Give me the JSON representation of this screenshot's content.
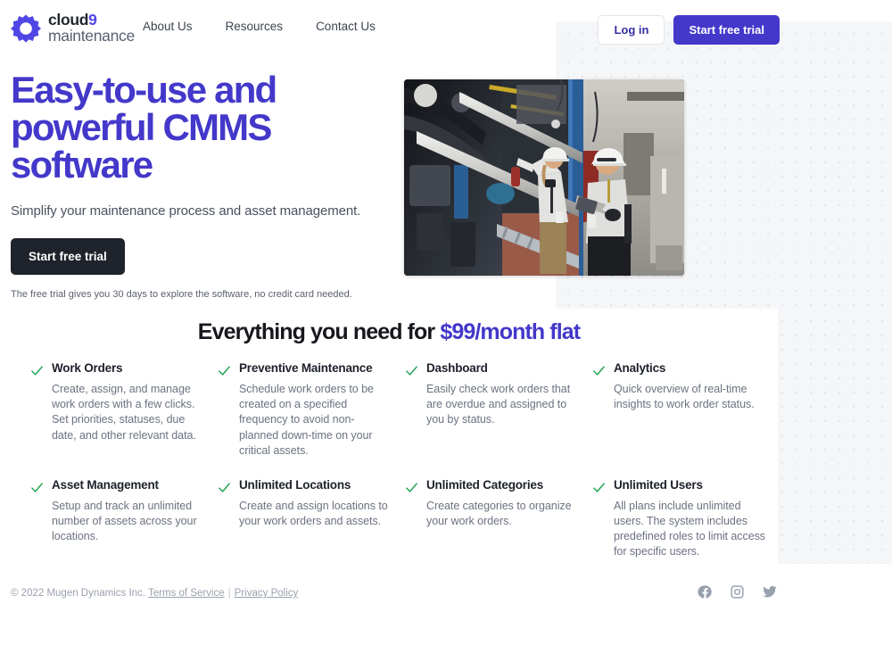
{
  "brand": {
    "logo_icon": "gear-icon",
    "name_part1": "cloud",
    "name_part2": "9",
    "name_part3": "maintenance",
    "accent_color": "#4f46e5"
  },
  "nav": {
    "items": [
      {
        "label": "About Us"
      },
      {
        "label": "Resources"
      },
      {
        "label": "Contact Us"
      }
    ]
  },
  "auth": {
    "login_label": "Log in",
    "trial_label": "Start free trial",
    "trial_bg": "#4338ca"
  },
  "hero": {
    "title": "Easy-to-use and\npowerful CMMS\nsoftware",
    "title_color": "#4338ca",
    "subtitle": "Simplify your maintenance process and asset management.",
    "cta_label": "Start free trial",
    "cta_bg": "#1f232b",
    "note": "The free trial gives you 30 days to explore the software, no credit card needed.",
    "image_alt": "two-technicians-in-hard-hats-inspecting-industrial-piping"
  },
  "features": {
    "heading_prefix": "Everything you need for ",
    "heading_accent": "$99/month flat",
    "check_color": "#22a251",
    "items": [
      {
        "title": "Work Orders",
        "desc": "Create, assign, and manage work orders with a few clicks. Set priorities, statuses, due date, and other relevant data."
      },
      {
        "title": "Preventive Maintenance",
        "desc": "Schedule work orders to be created on a specified frequency to avoid non-planned down-time on your critical assets."
      },
      {
        "title": "Dashboard",
        "desc": "Easily check work orders that are overdue and assigned to you by status."
      },
      {
        "title": "Analytics",
        "desc": "Quick overview of real-time insights to work order status."
      },
      {
        "title": "Asset Management",
        "desc": "Setup and track an unlimited number of assets across your locations."
      },
      {
        "title": "Unlimited Locations",
        "desc": "Create and assign locations to your work orders and assets."
      },
      {
        "title": "Unlimited Categories",
        "desc": "Create categories to organize your work orders."
      },
      {
        "title": "Unlimited Users",
        "desc": "All plans include unlimited users. The system includes predefined roles to limit access for specific users."
      }
    ]
  },
  "footer": {
    "copyright": "© 2022 Mugen Dynamics Inc.",
    "terms_label": "Terms of Service",
    "separator": "|",
    "privacy_label": "Privacy Policy",
    "socials": [
      {
        "name": "facebook-icon"
      },
      {
        "name": "instagram-icon"
      },
      {
        "name": "twitter-icon"
      }
    ]
  }
}
